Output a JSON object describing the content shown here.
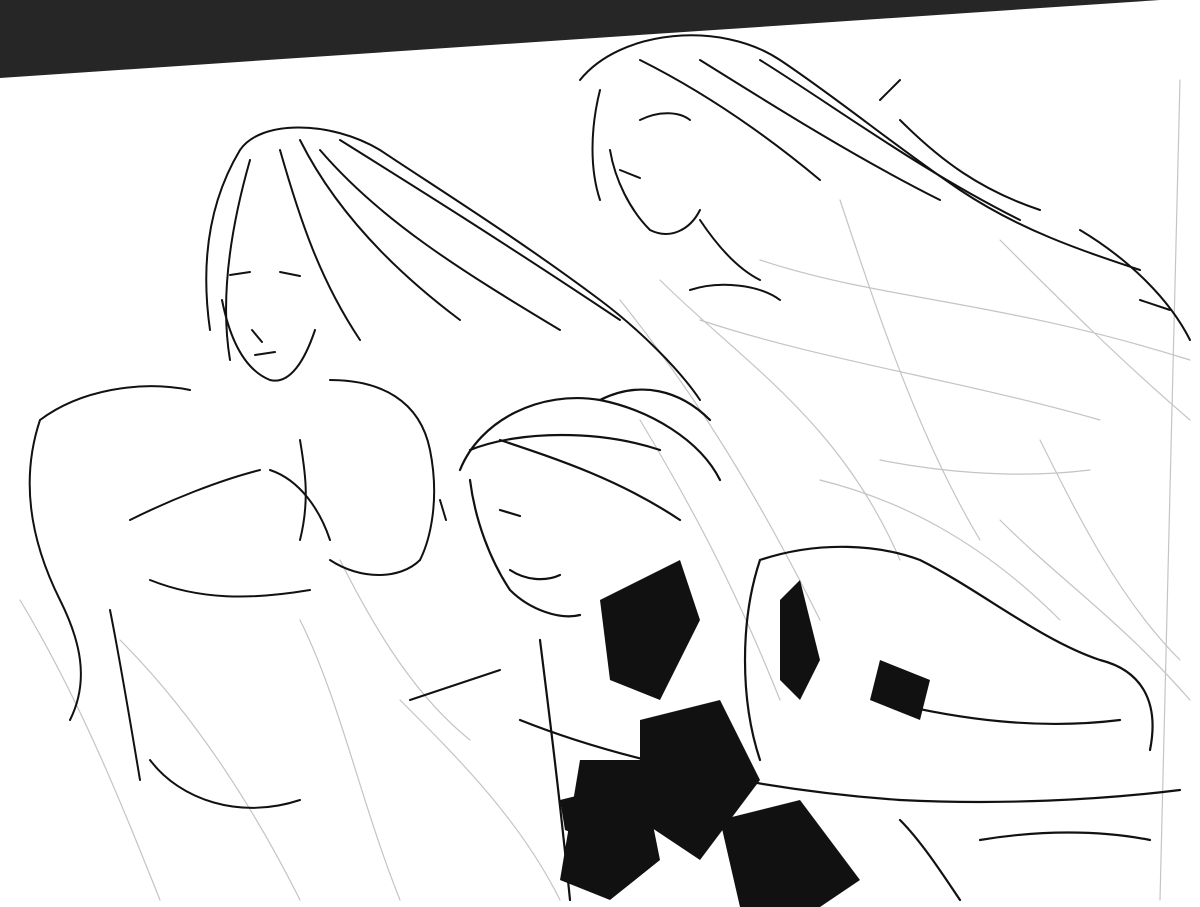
{
  "app": {
    "workspace_color": "#262626",
    "canvas_color": "#ffffff",
    "ink_color": "#111111",
    "sketch_color": "#b8b8b8"
  },
  "canvas": {
    "content": "line-art-sketch",
    "figures": [
      {
        "id": "figure-left",
        "pose": "shirtless-long-hair-front"
      },
      {
        "id": "figure-top-right",
        "pose": "long-hair-profile-smiling"
      },
      {
        "id": "figure-bottom-center",
        "pose": "short-hair-profile-laughing-dark-vest"
      }
    ]
  }
}
